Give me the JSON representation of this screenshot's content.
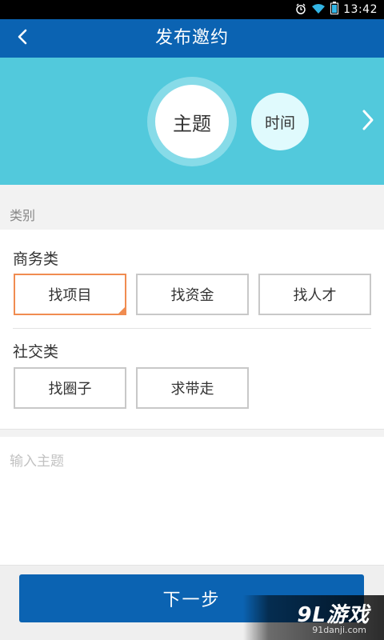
{
  "status_bar": {
    "time": "13:42",
    "icons": [
      "alarm-icon",
      "wifi-icon",
      "battery-icon"
    ]
  },
  "app_bar": {
    "title": "发布邀约",
    "back_icon": "chevron-left-icon"
  },
  "steps": {
    "current": "主题",
    "next": "时间",
    "arrow_icon": "chevron-right-icon"
  },
  "category": {
    "label": "类别",
    "groups": [
      {
        "title": "商务类",
        "options": [
          "找项目",
          "找资金",
          "找人才"
        ],
        "selected": "找项目"
      },
      {
        "title": "社交类",
        "options": [
          "找圈子",
          "求带走"
        ]
      }
    ]
  },
  "topic": {
    "placeholder": "输入主题",
    "value": ""
  },
  "footer": {
    "next_label": "下一步"
  },
  "watermark": {
    "brand": "9L游戏",
    "domain": "91danji.com"
  },
  "colors": {
    "primary": "#0b63b2",
    "hero": "#52c9dc",
    "accent": "#f08c50"
  }
}
